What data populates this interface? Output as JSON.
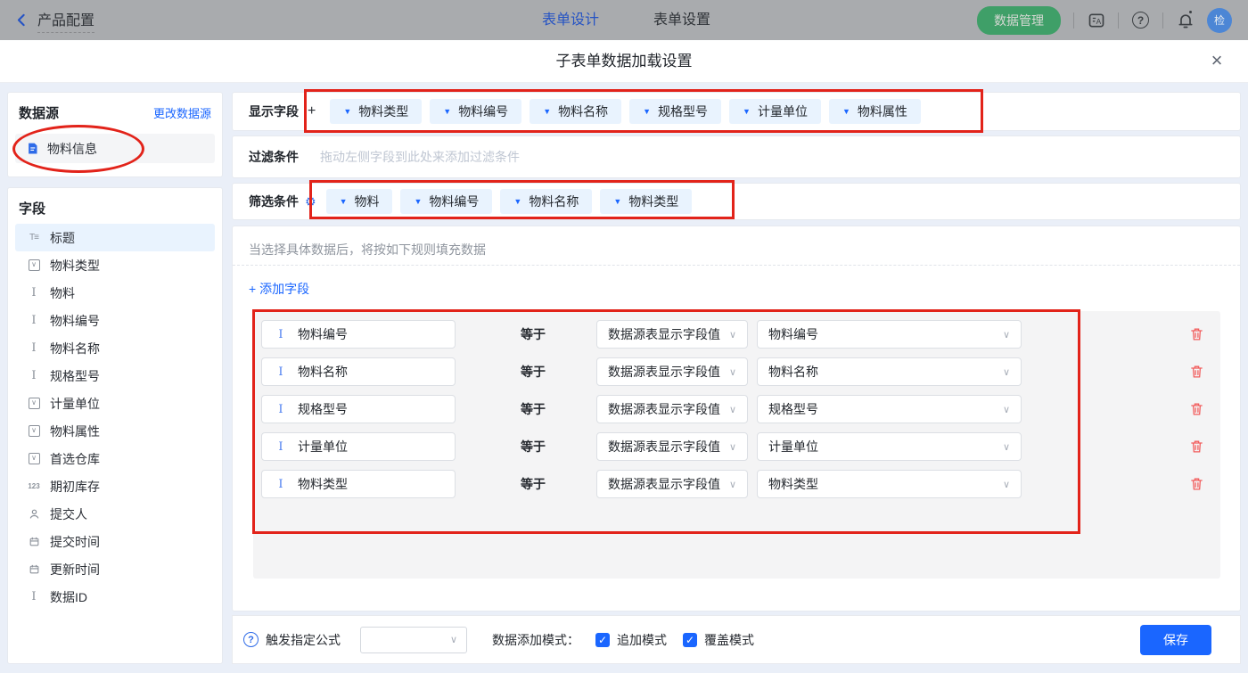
{
  "topbar": {
    "back_label": "产品配置",
    "tabs": [
      {
        "label": "表单设计",
        "active": true
      },
      {
        "label": "表单设置",
        "active": false
      }
    ],
    "data_manage_button": "数据管理",
    "avatar_text": "检"
  },
  "modal": {
    "title": "子表单数据加载设置",
    "close": "×"
  },
  "sidebar": {
    "datasource": {
      "title": "数据源",
      "change_link": "更改数据源",
      "item": "物料信息"
    },
    "fields": {
      "title": "字段",
      "items": [
        {
          "label": "标题",
          "icon": "title-field-icon",
          "selected": true
        },
        {
          "label": "物料类型",
          "icon": "select-field-icon",
          "selected": false
        },
        {
          "label": "物料",
          "icon": "text-field-icon",
          "selected": false
        },
        {
          "label": "物料编号",
          "icon": "text-field-icon",
          "selected": false
        },
        {
          "label": "物料名称",
          "icon": "text-field-icon",
          "selected": false
        },
        {
          "label": "规格型号",
          "icon": "text-field-icon",
          "selected": false
        },
        {
          "label": "计量单位",
          "icon": "select-field-icon",
          "selected": false
        },
        {
          "label": "物料属性",
          "icon": "select-field-icon",
          "selected": false
        },
        {
          "label": "首选仓库",
          "icon": "select-field-icon",
          "selected": false
        },
        {
          "label": "期初库存",
          "icon": "number-field-icon",
          "selected": false
        },
        {
          "label": "提交人",
          "icon": "user-field-icon",
          "selected": false
        },
        {
          "label": "提交时间",
          "icon": "date-field-icon",
          "selected": false
        },
        {
          "label": "更新时间",
          "icon": "date-field-icon",
          "selected": false
        },
        {
          "label": "数据ID",
          "icon": "text-field-icon",
          "selected": false
        }
      ]
    }
  },
  "display_fields": {
    "label": "显示字段",
    "tags": [
      "物料类型",
      "物料编号",
      "物料名称",
      "规格型号",
      "计量单位",
      "物料属性"
    ]
  },
  "filter": {
    "label": "过滤条件",
    "placeholder": "拖动左侧字段到此处来添加过滤条件"
  },
  "screening": {
    "label": "筛选条件",
    "tags": [
      "物料",
      "物料编号",
      "物料名称",
      "物料类型"
    ]
  },
  "rules": {
    "hint": "当选择具体数据后，将按如下规则填充数据",
    "add_field_label": "添加字段",
    "equals_label": "等于",
    "rows": [
      {
        "field": "物料编号",
        "source": "数据源表显示字段值",
        "value": "物料编号"
      },
      {
        "field": "物料名称",
        "source": "数据源表显示字段值",
        "value": "物料名称"
      },
      {
        "field": "规格型号",
        "source": "数据源表显示字段值",
        "value": "规格型号"
      },
      {
        "field": "计量单位",
        "source": "数据源表显示字段值",
        "value": "计量单位"
      },
      {
        "field": "物料类型",
        "source": "数据源表显示字段值",
        "value": "物料类型"
      }
    ]
  },
  "footer": {
    "formula_label": "触发指定公式",
    "mode_label": "数据添加模式：",
    "checkboxes": [
      {
        "label": "追加模式",
        "checked": true
      },
      {
        "label": "覆盖模式",
        "checked": true
      }
    ],
    "save_label": "保存"
  },
  "colors": {
    "accent_blue": "#1a66ff",
    "tag_background": "#e9f3fe",
    "green_button": "#3f9f68",
    "annotation_red": "#e2231a",
    "trash_red": "#f25c5c",
    "page_background": "#eaeff8"
  }
}
